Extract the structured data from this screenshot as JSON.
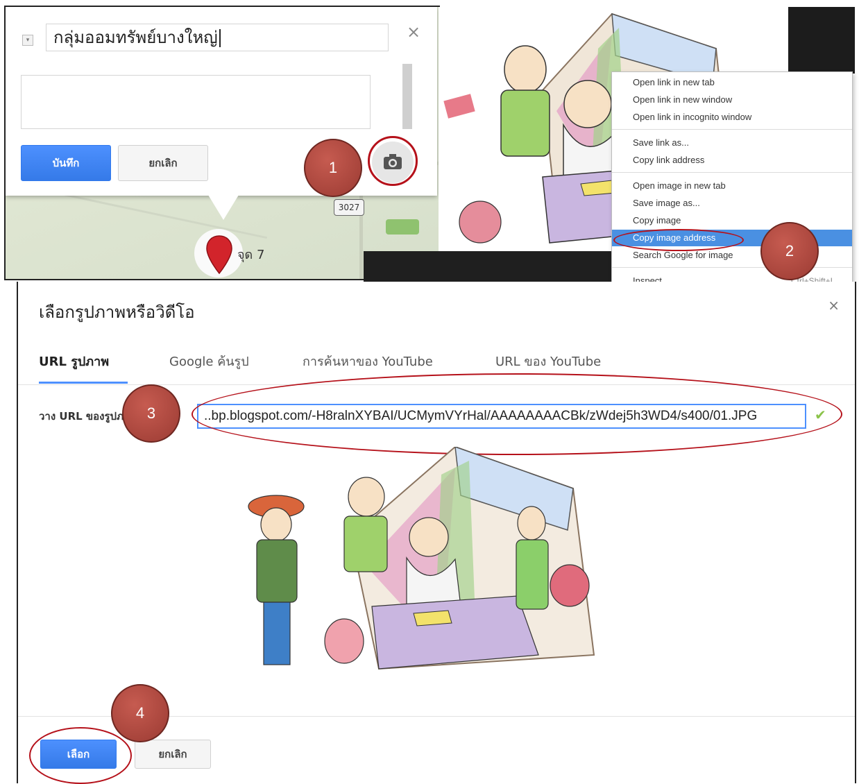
{
  "map_editor": {
    "place_title": "กลุ่มออมทรัพย์บางใหญ่",
    "close_symbol": "×",
    "save_label": "บันทึก",
    "cancel_label": "ยกเลิก",
    "camera_icon": "camera-icon",
    "route_number": "3027",
    "pin_label": "จุด 7"
  },
  "context_menu": {
    "items": [
      {
        "label": "Open link in new tab"
      },
      {
        "label": "Open link in new window"
      },
      {
        "label": "Open link in incognito window"
      },
      {
        "label": "Save link as..."
      },
      {
        "label": "Copy link address"
      },
      {
        "label": "Open image in new tab"
      },
      {
        "label": "Save image as..."
      },
      {
        "label": "Copy image"
      },
      {
        "label": "Copy image address"
      },
      {
        "label": "Search Google for image"
      },
      {
        "label": "Inspect",
        "shortcut": "Ctrl+Shift+I"
      }
    ]
  },
  "badges": [
    "1",
    "2",
    "3",
    "4"
  ],
  "dialog": {
    "title": "เลือกรูปภาพหรือวิดีโอ",
    "close_symbol": "×",
    "tabs": [
      "URL รูปภาพ",
      "Google ค้นรูป",
      "การค้นหาของ YouTube",
      "URL ของ YouTube"
    ],
    "url_label": "วาง URL ของรูปภาพที่นี่",
    "url_value": "..bp.blogspot.com/-H8ralnXYBAI/UCMymVYrHal/AAAAAAAACBk/zWdej5h3WD4/s400/01.JPG",
    "select_label": "เลือก",
    "cancel_label": "ยกเลิก"
  },
  "colors": {
    "accent_blue": "#4d90fe",
    "annotation_red": "#b5111a",
    "badge_red": "#a8443a",
    "menu_highlight": "#4a90e2"
  }
}
